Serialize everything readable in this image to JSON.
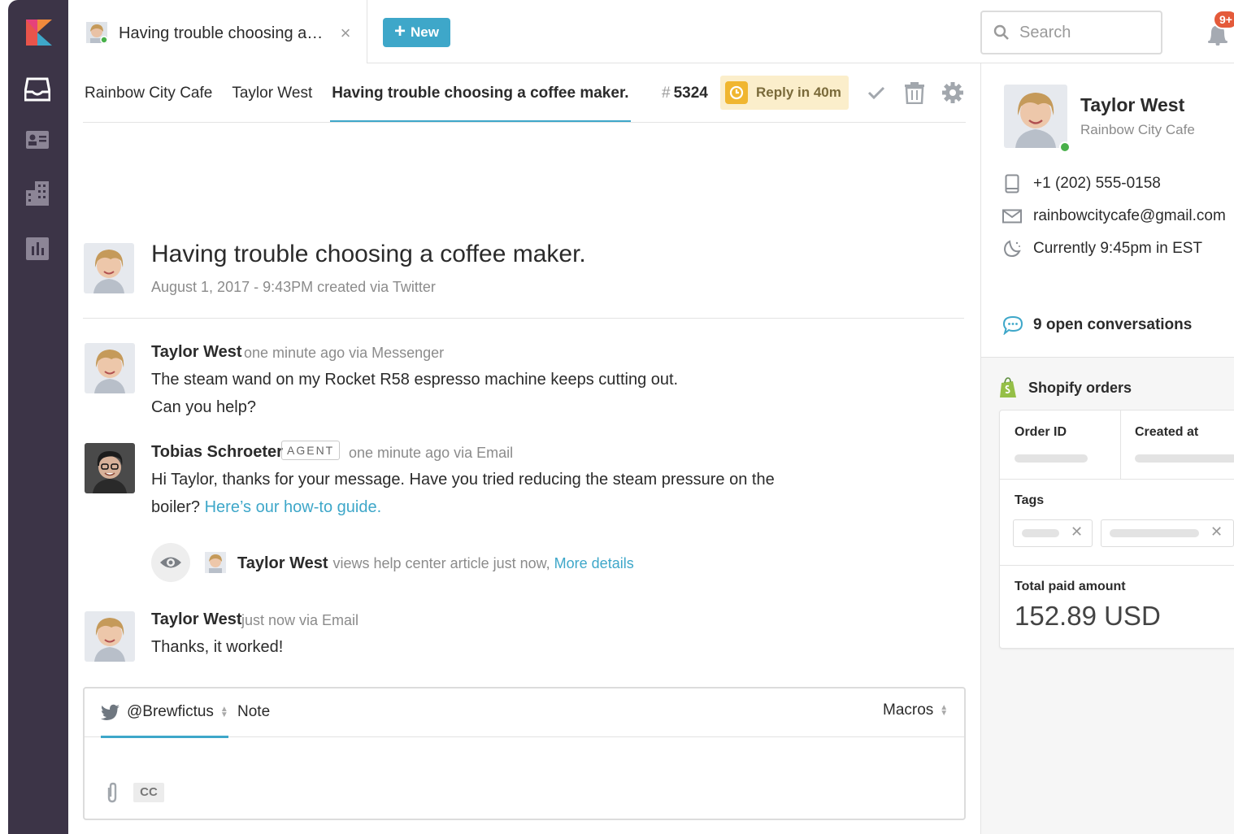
{
  "colors": {
    "nav_bg": "#3c3447",
    "accent": "#3ea7c9",
    "reply_bg": "#fbeecb",
    "reply_icon": "#f0b630",
    "badge": "#e45a3a",
    "online": "#48b04a",
    "shopify_green": "#95bf47"
  },
  "leftnav": {
    "icons": [
      "kustomer-logo-icon",
      "inbox-icon",
      "contact-card-icon",
      "building-icon",
      "reports-icon"
    ]
  },
  "topbar": {
    "tab_title": "Having trouble choosing a…",
    "new_label": "New",
    "search_placeholder": "Search",
    "notif_badge": "9+"
  },
  "header": {
    "breadcrumbs": [
      "Rainbow City Cafe",
      "Taylor West",
      "Having trouble choosing a coffee maker."
    ],
    "ticket_hash": "#",
    "ticket_number": "5324",
    "reply_timer": "Reply in 40m"
  },
  "conversation": {
    "title": "Having trouble choosing a coffee maker.",
    "meta": "August 1, 2017 - 9:43PM created via Twitter",
    "messages": [
      {
        "name": "Taylor West",
        "meta": "one minute ago via Messenger",
        "lines": [
          "The steam wand on my Rocket R58 espresso machine keeps cutting out.",
          "Can you help?"
        ]
      },
      {
        "name": "Tobias Schroeter",
        "badge": "AGENT",
        "meta": "one minute ago via Email",
        "line1": "Hi Taylor, thanks for your message. Have you tried reducing the steam pressure on the",
        "line2_prefix": "boiler? ",
        "line2_link": "Here’s our how-to guide."
      },
      {
        "name": "Taylor West",
        "meta": "just now via Email",
        "lines": [
          "Thanks, it worked!"
        ]
      }
    ],
    "activity": {
      "name": "Taylor West",
      "text": "views help center article just now, ",
      "link": "More details"
    }
  },
  "composer": {
    "channel_tab": "@Brewfictus",
    "note_tab": "Note",
    "macros": "Macros",
    "cc": "CC"
  },
  "contact": {
    "name": "Taylor West",
    "company": "Rainbow City Cafe",
    "phone": "+1 (202) 555-0158",
    "email": "rainbowcitycafe@gmail.com",
    "local_time": "Currently 9:45pm in EST",
    "open_conversations": "9 open conversations"
  },
  "shopify": {
    "title": "Shopify orders",
    "col_order_id": "Order ID",
    "col_created_at": "Created at",
    "tags_label": "Tags",
    "total_label": "Total paid amount",
    "total_value": "152.89 USD"
  }
}
